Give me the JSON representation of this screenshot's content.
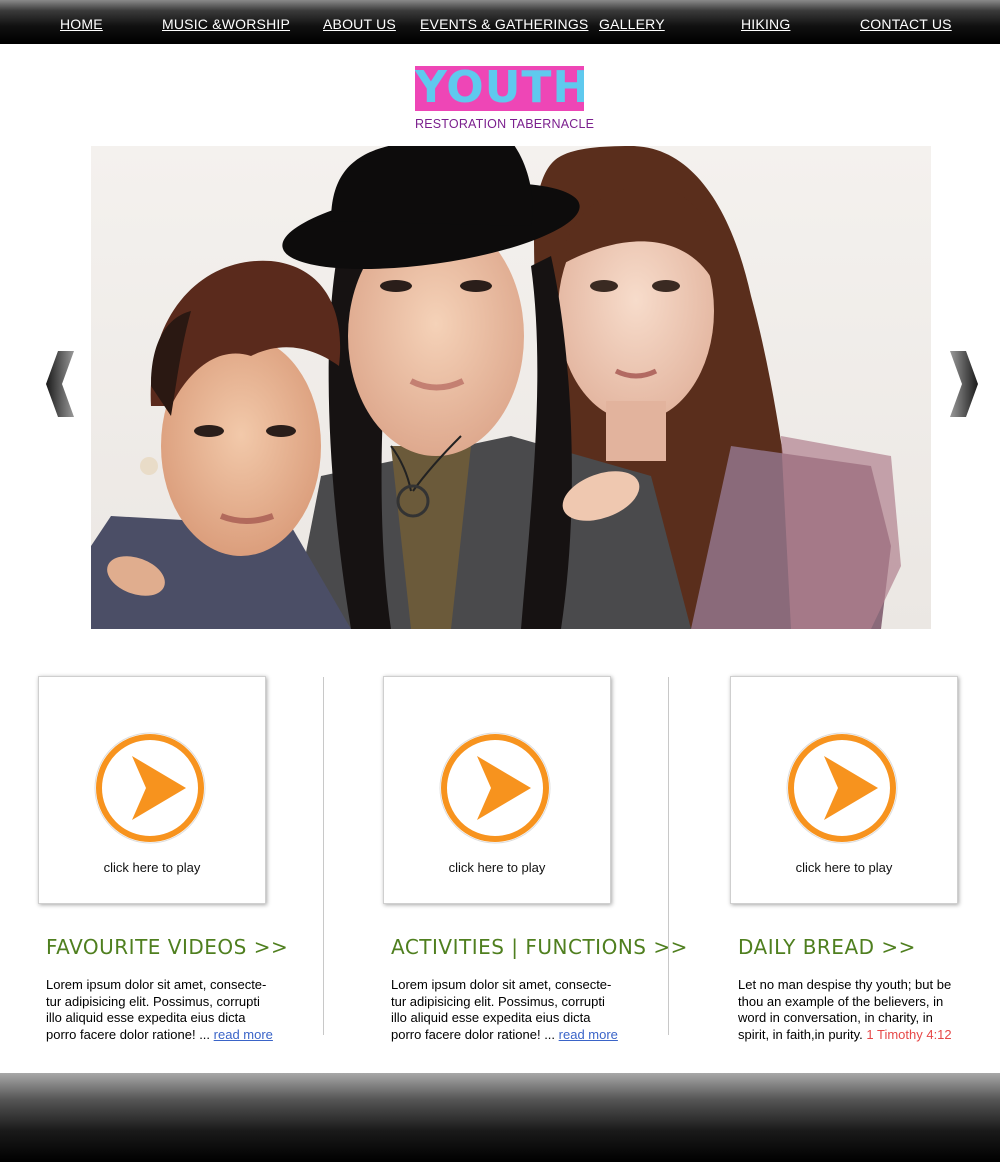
{
  "nav": {
    "items": [
      {
        "label": "HOME"
      },
      {
        "label": "MUSIC &WORSHIP"
      },
      {
        "label": "ABOUT US"
      },
      {
        "label": "EVENTS & GATHERINGS"
      },
      {
        "label": "GALLERY"
      },
      {
        "label": "HIKING"
      },
      {
        "label": "CONTACT US"
      }
    ]
  },
  "logo": {
    "word": "YOUTH",
    "subtitle": "RESTORATION TABERNACLE",
    "colors": {
      "box": "#ee46b6",
      "word": "#5fc9ee",
      "subtitle": "#7b1f8e"
    }
  },
  "hero": {
    "prev_icon": "chevron-left-icon",
    "next_icon": "chevron-right-icon"
  },
  "columns": [
    {
      "card_caption": "click here to play",
      "heading": "FAVOURITE VIDEOS >>",
      "text_lines": [
        "Lorem ipsum dolor sit amet, consecte-",
        "tur adipisicing elit. Possimus, corrupti",
        "illo aliquid esse expedita eius dicta",
        "porro facere dolor ratione! ... "
      ],
      "link": "read more"
    },
    {
      "card_caption": "click here to play",
      "heading": "ACTIVITIES | FUNCTIONS >>",
      "text_lines": [
        "Lorem ipsum dolor sit amet, consecte-",
        "tur adipisicing elit. Possimus, corrupti",
        "illo aliquid esse expedita eius dicta",
        "porro facere dolor ratione! ... "
      ],
      "link": "read more"
    },
    {
      "card_caption": "click here to play",
      "heading": "DAILY BREAD >>",
      "text_lines": [
        "Let no man despise thy youth; but be",
        "thou an example of the believers, in",
        "word in conversation, in charity, in",
        "spirit, in faith,in purity. "
      ],
      "link": "1 Timothy 4:12"
    }
  ],
  "colors": {
    "accent_orange": "#f7931e",
    "heading_green": "#4f7f1f",
    "link_blue": "#3a64c8",
    "verse_red": "#e64848"
  }
}
